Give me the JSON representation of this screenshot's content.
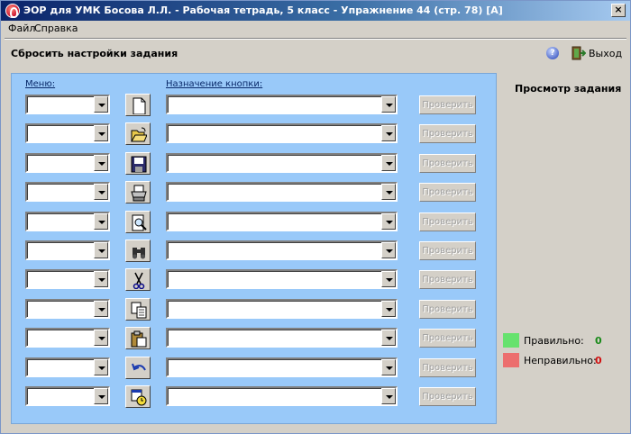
{
  "window": {
    "title": "ЭОР для УМК Босова Л.Л. - Рабочая тетрадь, 5 класс - Упражнение 44 (стр. 78) [A]",
    "close_label": "×"
  },
  "menubar": {
    "file": "Файл",
    "help": "Справка"
  },
  "toolbar": {
    "reset_label": "Сбросить настройки задания",
    "help_glyph": "?",
    "exit_label": "Выход"
  },
  "panel": {
    "menu_header": "Меню:",
    "purpose_header": "Назначение кнопки:"
  },
  "rows": [
    {
      "icon": "new-document-icon",
      "menu_value": "",
      "purpose_value": "",
      "check_label": "Проверить"
    },
    {
      "icon": "open-folder-icon",
      "menu_value": "",
      "purpose_value": "",
      "check_label": "Проверить"
    },
    {
      "icon": "save-disk-icon",
      "menu_value": "",
      "purpose_value": "",
      "check_label": "Проверить"
    },
    {
      "icon": "print-icon",
      "menu_value": "",
      "purpose_value": "",
      "check_label": "Проверить"
    },
    {
      "icon": "print-preview-icon",
      "menu_value": "",
      "purpose_value": "",
      "check_label": "Проверить"
    },
    {
      "icon": "binoculars-find-icon",
      "menu_value": "",
      "purpose_value": "",
      "check_label": "Проверить"
    },
    {
      "icon": "scissors-cut-icon",
      "menu_value": "",
      "purpose_value": "",
      "check_label": "Проверить"
    },
    {
      "icon": "copy-icon",
      "menu_value": "",
      "purpose_value": "",
      "check_label": "Проверить"
    },
    {
      "icon": "paste-clipboard-icon",
      "menu_value": "",
      "purpose_value": "",
      "check_label": "Проверить"
    },
    {
      "icon": "undo-icon",
      "menu_value": "",
      "purpose_value": "",
      "check_label": "Проверить"
    },
    {
      "icon": "date-time-icon",
      "menu_value": "",
      "purpose_value": "",
      "check_label": "Проверить"
    }
  ],
  "preview": {
    "title": "Просмотр задания",
    "correct_label": "Правильно:",
    "correct_count": "0",
    "correct_color": "#66e26e",
    "incorrect_label": "Неправильно:",
    "incorrect_count": "0",
    "incorrect_color": "#ec6e6e"
  }
}
